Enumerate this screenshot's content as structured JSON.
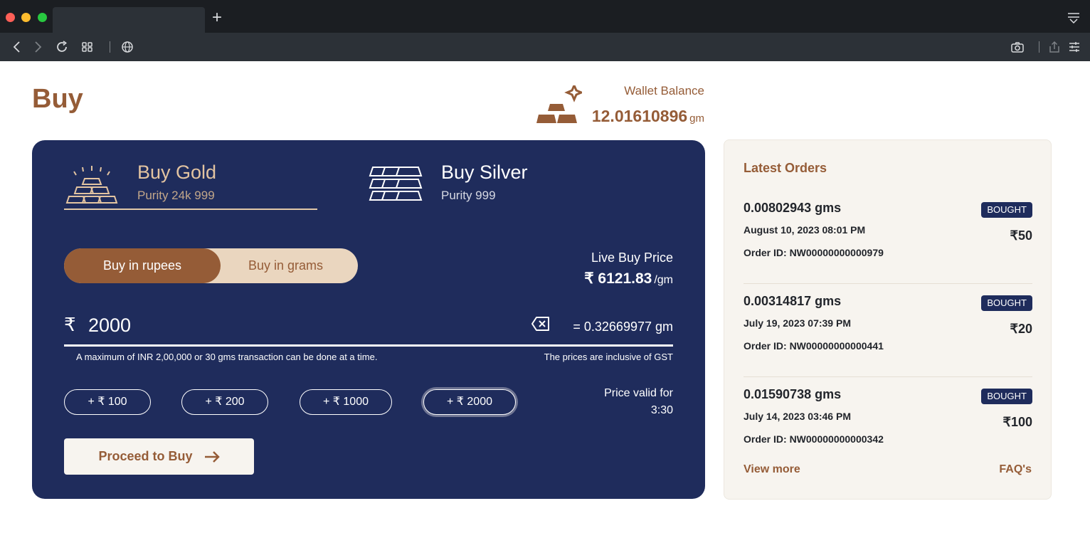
{
  "browser": {
    "new_tab_label": "+"
  },
  "page": {
    "title": "Buy"
  },
  "wallet": {
    "label": "Wallet Balance",
    "value": "12.01610896",
    "unit": "gm",
    "icon": "gold-bars-icon"
  },
  "metals": [
    {
      "name": "Buy Gold",
      "purity": "Purity 24k 999",
      "icon": "gold-bars-icon",
      "selected": true
    },
    {
      "name": "Buy Silver",
      "purity": "Purity 999",
      "icon": "silver-bars-icon",
      "selected": false
    }
  ],
  "modes": {
    "rupees": "Buy in rupees",
    "grams": "Buy in grams",
    "selected": "rupees"
  },
  "live_price": {
    "label": "Live Buy Price",
    "value": "₹ 6121.83",
    "unit": "/gm"
  },
  "amount": {
    "currency_symbol": "₹",
    "value": "2000",
    "converted": "= 0.32669977 gm",
    "note_left": "A maximum of INR 2,00,000 or 30 gms transaction can be done at a time.",
    "note_right": "The prices are inclusive of GST"
  },
  "quick_add": [
    "+ ₹ 100",
    "+ ₹ 200",
    "+ ₹ 1000",
    "+ ₹ 2000"
  ],
  "price_valid": {
    "label": "Price valid for",
    "time": "3:30"
  },
  "proceed_label": "Proceed to Buy",
  "orders": {
    "title": "Latest Orders",
    "items": [
      {
        "qty": "0.00802943 gms",
        "date": "August 10, 2023 08:01 PM",
        "order_id": "Order ID: NW00000000000979",
        "status": "BOUGHT",
        "amount": "₹50"
      },
      {
        "qty": "0.00314817 gms",
        "date": "July 19, 2023 07:39 PM",
        "order_id": "Order ID: NW00000000000441",
        "status": "BOUGHT",
        "amount": "₹20"
      },
      {
        "qty": "0.01590738 gms",
        "date": "July 14, 2023 03:46 PM",
        "order_id": "Order ID: NW00000000000342",
        "status": "BOUGHT",
        "amount": "₹100"
      }
    ],
    "view_more": "View more",
    "faqs": "FAQ's"
  },
  "colors": {
    "brand_brown": "#955c37",
    "navy": "#1f2c5c",
    "cream": "#f7f4ef",
    "toggle_light": "#ead6bf"
  }
}
